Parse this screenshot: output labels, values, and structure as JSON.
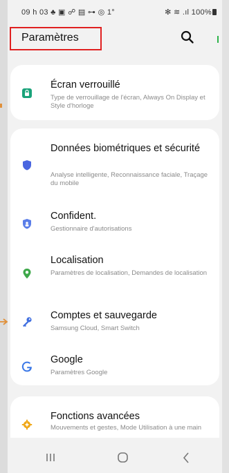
{
  "status_bar": {
    "time_icons": "09 h 03 ♣ ▣ ☍ ▤ ⊶ ◎ 1°",
    "right": "✻ ≋ .ıl 100%"
  },
  "header": {
    "title": "Paramètres",
    "search_icon": "search-icon"
  },
  "settings": [
    {
      "title": "Écran verrouillé",
      "subtitle": "Type de verrouillage de l'écran, Always On Display et Style d'horloge",
      "icon": "lock-icon",
      "color": "#1aa37a"
    },
    {
      "title": "Données biométriques et sécurité",
      "subtitle": "Analyse intelligente, Reconnaissance faciale, Traçage du mobile",
      "icon": "shield-icon",
      "color": "#4a66e0"
    },
    {
      "title": "Confident.",
      "subtitle": "Gestionnaire d'autorisations",
      "icon": "privacy-shield-icon",
      "color": "#5a7de8"
    },
    {
      "title": "Localisation",
      "subtitle": "Paramètres de localisation, Demandes de localisation",
      "icon": "location-pin-icon",
      "color": "#3ea84a"
    },
    {
      "title": "Comptes et sauvegarde",
      "subtitle": "Samsung Cloud, Smart Switch",
      "icon": "key-icon",
      "color": "#3f6ee0"
    },
    {
      "title": "Google",
      "subtitle": "Paramètres Google",
      "icon": "google-icon",
      "color": "#3b78e7"
    },
    {
      "title": "Fonctions avancées",
      "subtitle": "Mouvements et gestes, Mode Utilisation à une main",
      "icon": "gear-plus-icon",
      "color": "#f0a81a"
    }
  ],
  "navbar": {
    "recent": "recent-apps-icon",
    "home": "home-icon",
    "back": "back-icon"
  },
  "colors": {
    "highlight_border": "#e02020",
    "annotation_arrow": "#e0903a"
  }
}
